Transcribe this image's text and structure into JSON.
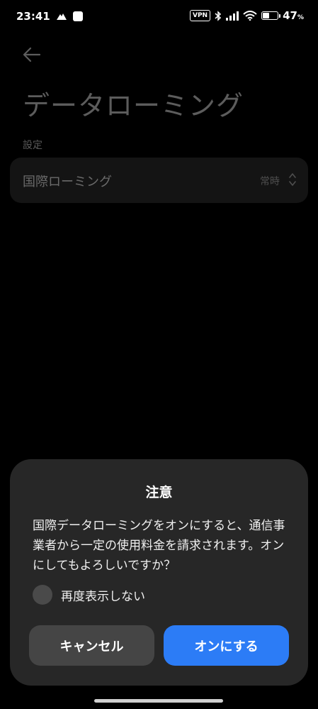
{
  "status_bar": {
    "time": "23:41",
    "vpn_label": "VPN",
    "battery_percent": "47",
    "battery_unit": "%",
    "battery_level": 0.47,
    "icons": [
      "mountain-icon",
      "square-app-icon",
      "bluetooth-icon",
      "signal-icon",
      "wifi-icon",
      "battery-icon"
    ]
  },
  "page": {
    "title": "データローミング",
    "section_label": "設定",
    "setting": {
      "label": "国際ローミング",
      "value": "常時"
    }
  },
  "dialog": {
    "title": "注意",
    "message": "国際データローミングをオンにすると、通信事業者から一定の使用料金を請求されます。オンにしてもよろしいですか？",
    "checkbox_label": "再度表示しない",
    "cancel_label": "キャンセル",
    "confirm_label": "オンにする"
  },
  "colors": {
    "accent": "#2c7cf6",
    "dialog_bg": "#272727",
    "cancel_bg": "#454545"
  }
}
